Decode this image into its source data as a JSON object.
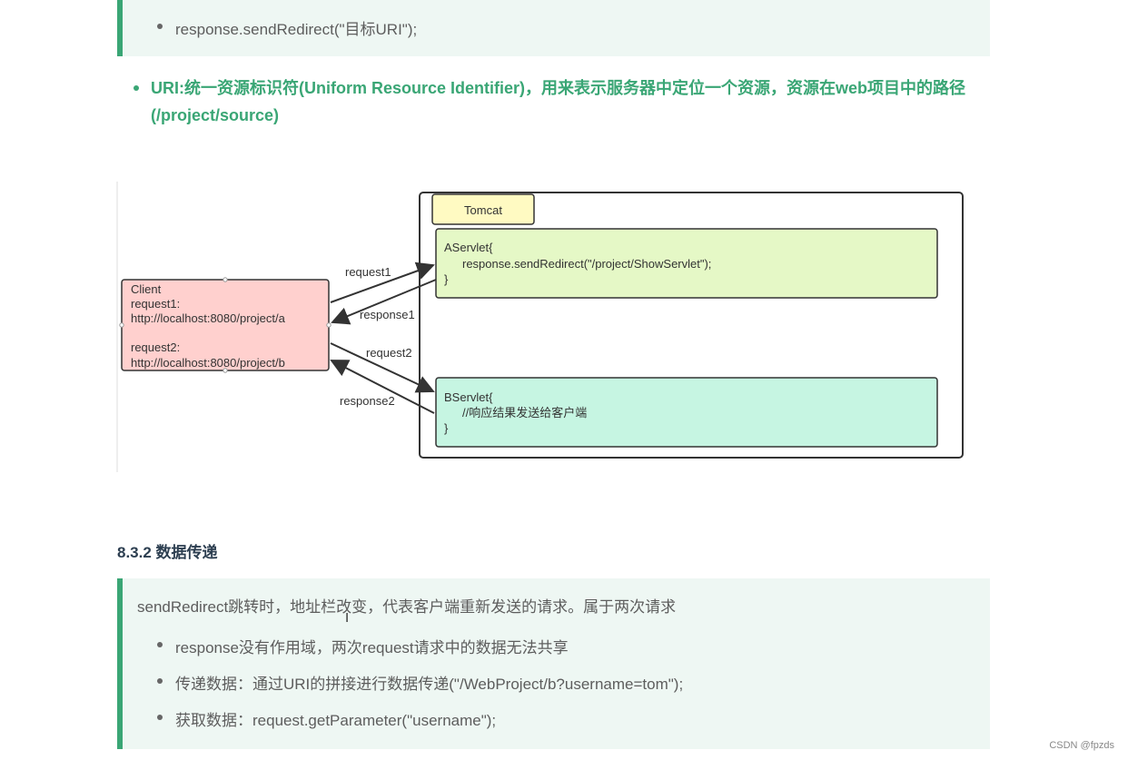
{
  "top_tip": {
    "item": "response.sendRedirect(\"目标URI\");"
  },
  "uri_note": "URI:统一资源标识符(Uniform Resource Identifier)，用来表示服务器中定位一个资源，资源在web项目中的路径(/project/source)",
  "diagram": {
    "tomcat_label": "Tomcat",
    "client_lines": [
      "Client",
      "request1:",
      "http://localhost:8080/project/a",
      "",
      "request2:",
      "http://localhost:8080/project/b"
    ],
    "aservlet_lines": [
      "AServlet{",
      "response.sendRedirect(\"/project/ShowServlet\");",
      "}"
    ],
    "bservlet_lines": [
      "BServlet{",
      "//响应结果发送给客户端",
      "}"
    ],
    "arrow_labels": {
      "request1": "request1",
      "response1": "response1",
      "request2": "request2",
      "response2": "response2"
    },
    "colors": {
      "client_fill": "#ffd0ce",
      "client_border": "#c0504d",
      "aservlet_fill": "#e5f8c6",
      "bservlet_fill": "#c6f5e2",
      "tomcat_fill": "#fffac2"
    }
  },
  "section_heading": "8.3.2 数据传递",
  "bottom_tip": {
    "lead": "sendRedirect跳转时，地址栏改变，代表客户端重新发送的请求。属于两次请求",
    "items": [
      "response没有作用域，两次request请求中的数据无法共享",
      "传递数据：通过URI的拼接进行数据传递(\"/WebProject/b?username=tom\");",
      "获取数据：request.getParameter(\"username\");"
    ]
  },
  "cursor_glyph": "I",
  "watermark": "CSDN @fpzds",
  "accent_color": "#3aa675"
}
